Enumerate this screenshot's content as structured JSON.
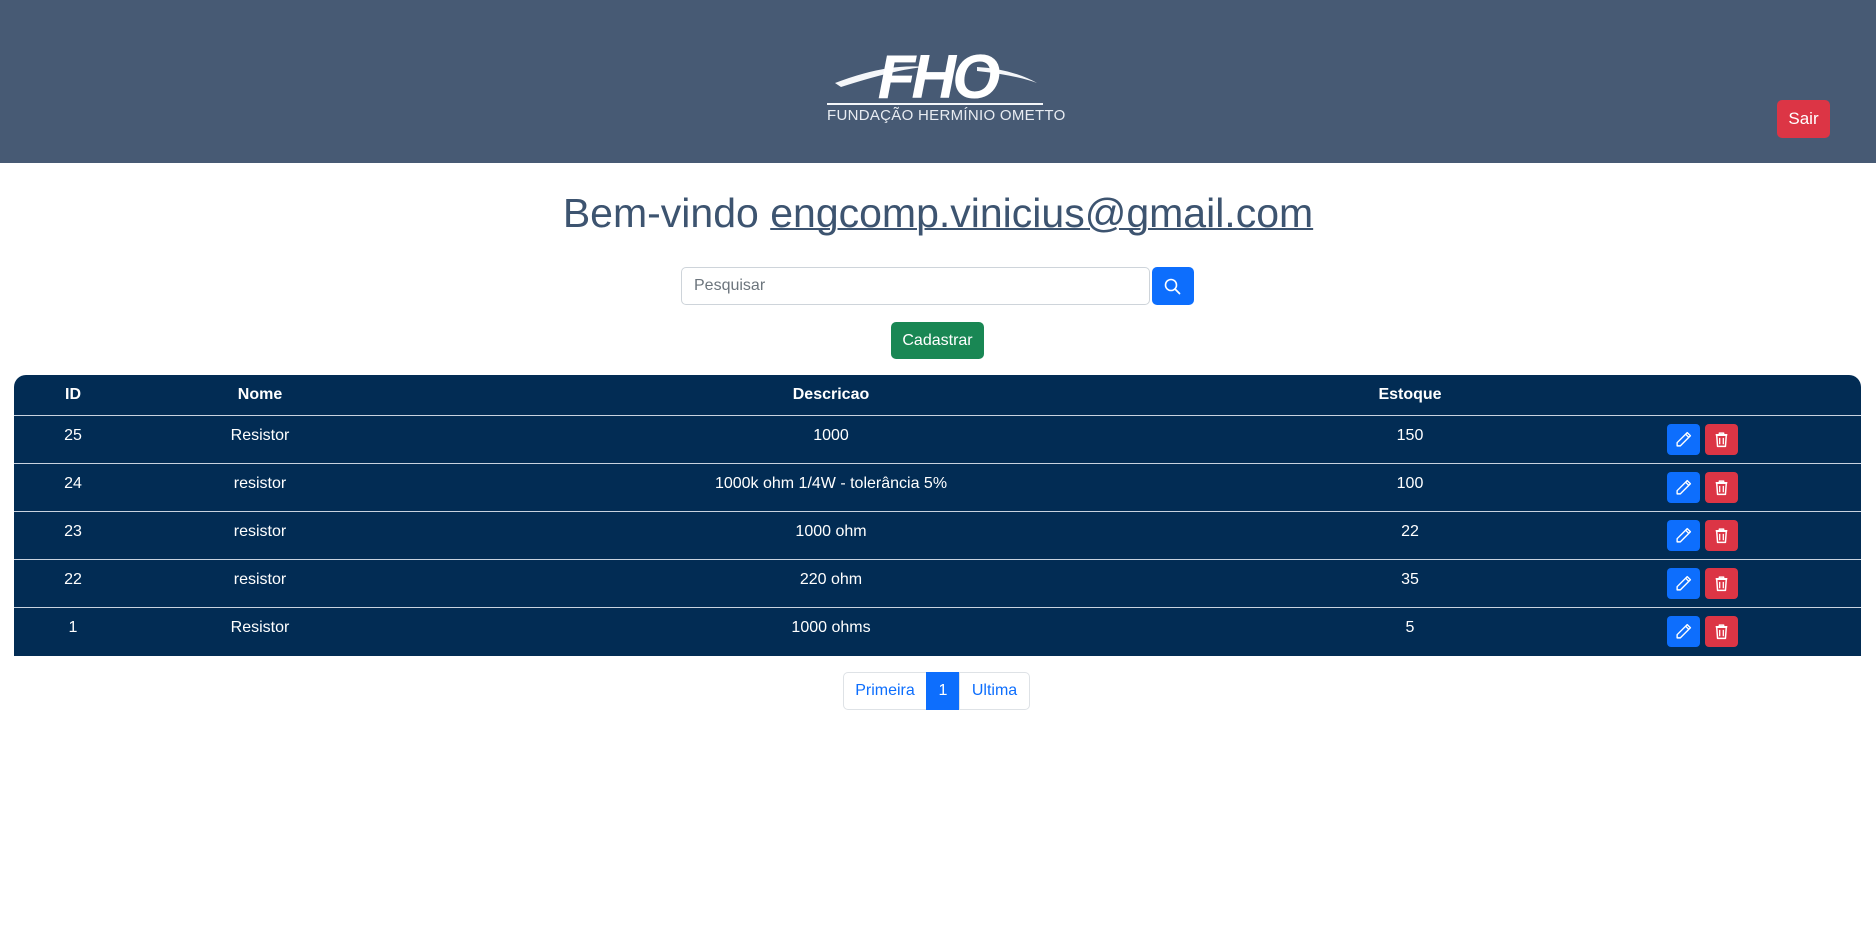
{
  "header": {
    "logo_text": "FHO",
    "logo_subtitle": "FUNDAÇÃO HERMÍNIO OMETTO",
    "logout_label": "Sair",
    "background_color": "#475a74"
  },
  "welcome": {
    "prefix": "Bem-vindo",
    "email": "engcomp.vinicius@gmail.com"
  },
  "search": {
    "placeholder": "Pesquisar",
    "value": "",
    "button_icon": "search-icon"
  },
  "register_label": "Cadastrar",
  "table": {
    "columns": [
      "ID",
      "Nome",
      "Descricao",
      "Estoque"
    ],
    "rows": [
      {
        "id": "25",
        "nome": "Resistor",
        "descricao": "1000",
        "estoque": "150"
      },
      {
        "id": "24",
        "nome": "resistor",
        "descricao": "1000k ohm 1/4W - tolerância 5%",
        "estoque": "100"
      },
      {
        "id": "23",
        "nome": "resistor",
        "descricao": "1000 ohm",
        "estoque": "22"
      },
      {
        "id": "22",
        "nome": "resistor",
        "descricao": "220 ohm",
        "estoque": "35"
      },
      {
        "id": "1",
        "nome": "Resistor",
        "descricao": "1000 ohms",
        "estoque": "5"
      }
    ],
    "row_actions": [
      "pencil-icon",
      "trash-icon"
    ],
    "background_color": "#022c54"
  },
  "pagination": {
    "first_label": "Primeira",
    "current_page": "1",
    "last_label": "Ultima"
  },
  "colors": {
    "primary": "#0d6efd",
    "danger": "#dc3545",
    "success": "#198754",
    "heading": "#3d5470"
  }
}
